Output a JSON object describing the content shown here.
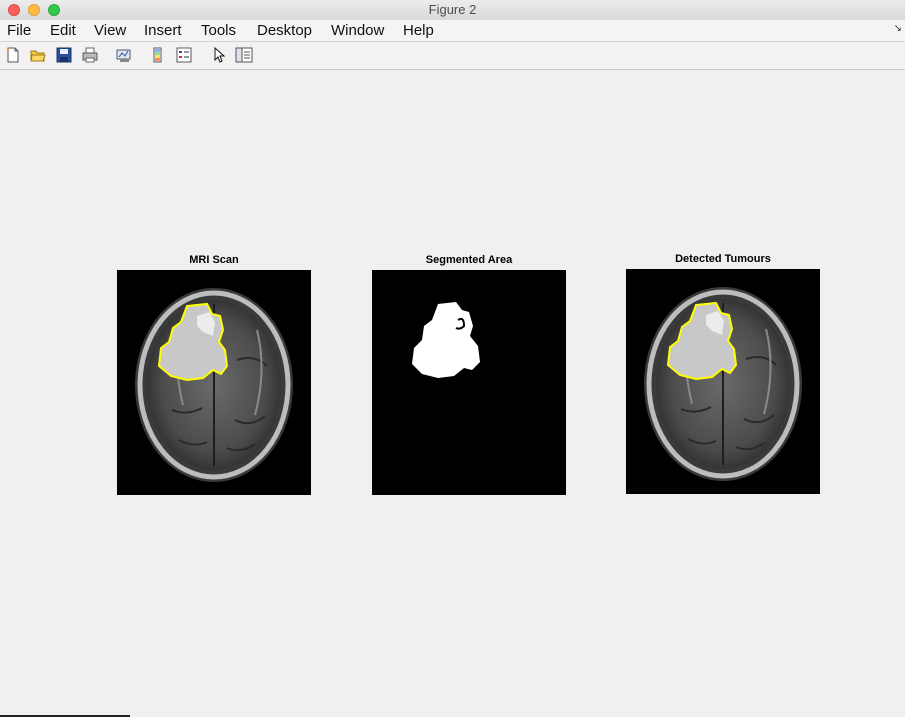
{
  "window": {
    "title": "Figure 2"
  },
  "menu": [
    "File",
    "Edit",
    "View",
    "Insert",
    "Tools",
    "Desktop",
    "Window",
    "Help"
  ],
  "toolbar": {
    "icons": [
      "new-figure-icon",
      "open-file-icon",
      "save-icon",
      "print-icon",
      "link-plot-icon",
      "insert-colorbar-icon",
      "insert-legend-icon",
      "edit-plot-arrow-icon",
      "property-inspector-icon"
    ]
  },
  "axes": [
    {
      "title": "MRI Scan"
    },
    {
      "title": "Segmented Area"
    },
    {
      "title": "Detected Tumours"
    }
  ],
  "colors": {
    "outline": "#ffff00",
    "background": "#f0f0f0"
  }
}
